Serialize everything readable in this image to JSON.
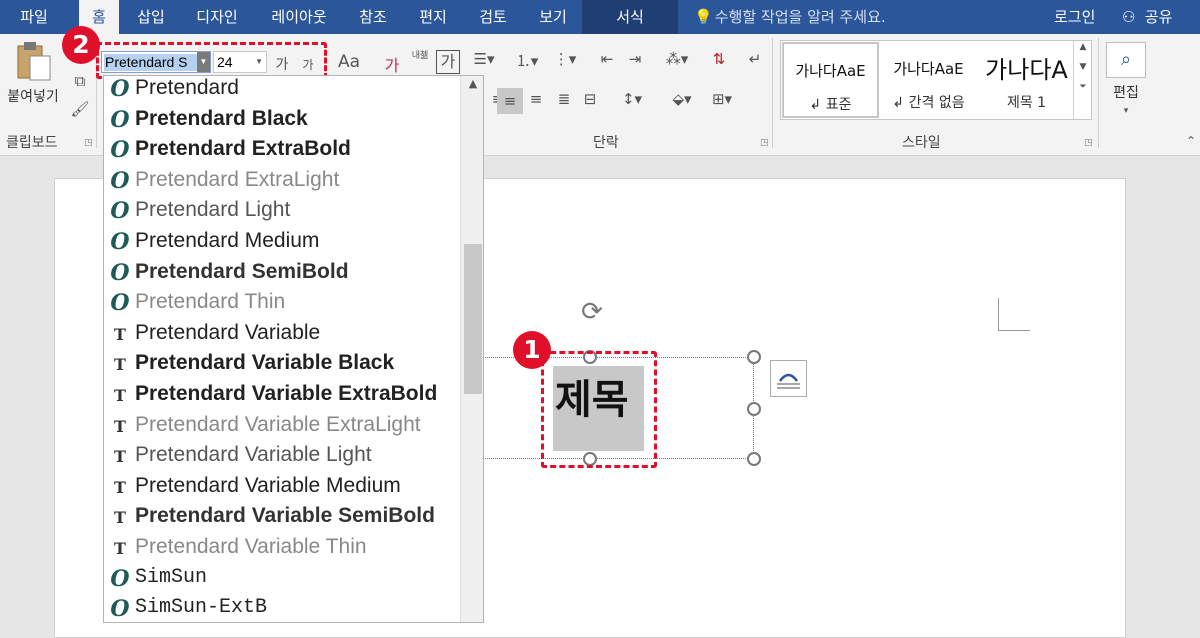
{
  "tabs": [
    "파일",
    "홈",
    "삽입",
    "디자인",
    "레이아웃",
    "참조",
    "편지",
    "검토",
    "보기",
    "서식"
  ],
  "active_tab": "홈",
  "tell_me": "수행할 작업을 알려 주세요.",
  "login": "로그인",
  "share": "공유",
  "clipboard": {
    "paste": "붙여넣기",
    "label": "클립보드"
  },
  "font_group": {
    "font_name": "Pretendard S",
    "font_size": "24",
    "grow": "가",
    "shrink": "가",
    "change_case": "Aa",
    "clear_format": "가",
    "phonetic": "내첾",
    "char_border": "가"
  },
  "paragraph_label": "단락",
  "styles": {
    "label": "스타일",
    "items": [
      {
        "sample": "가나다AaE",
        "name": "↲ 표준"
      },
      {
        "sample": "가나다AaE",
        "name": "↲ 간격 없음"
      },
      {
        "sample": "가나다A",
        "name": "제목 1"
      }
    ]
  },
  "editing": {
    "label": "편집"
  },
  "document": {
    "title_text": "제목"
  },
  "annotations": {
    "badge1": "1",
    "badge2": "2"
  },
  "font_list": [
    {
      "name": "Pretendard",
      "icon": "opentype-icon",
      "weight": "normal"
    },
    {
      "name": "Pretendard Black",
      "icon": "opentype-icon",
      "weight": "900"
    },
    {
      "name": "Pretendard ExtraBold",
      "icon": "opentype-icon",
      "weight": "800"
    },
    {
      "name": "Pretendard ExtraLight",
      "icon": "opentype-icon",
      "weight": "200"
    },
    {
      "name": "Pretendard Light",
      "icon": "opentype-icon",
      "weight": "300"
    },
    {
      "name": "Pretendard Medium",
      "icon": "opentype-icon",
      "weight": "500"
    },
    {
      "name": "Pretendard SemiBold",
      "icon": "opentype-icon",
      "weight": "600"
    },
    {
      "name": "Pretendard Thin",
      "icon": "opentype-icon",
      "weight": "100"
    },
    {
      "name": "Pretendard Variable",
      "icon": "truetype-icon",
      "weight": "normal"
    },
    {
      "name": "Pretendard Variable Black",
      "icon": "truetype-icon",
      "weight": "900"
    },
    {
      "name": "Pretendard Variable ExtraBold",
      "icon": "truetype-icon",
      "weight": "800"
    },
    {
      "name": "Pretendard Variable ExtraLight",
      "icon": "truetype-icon",
      "weight": "200"
    },
    {
      "name": "Pretendard Variable Light",
      "icon": "truetype-icon",
      "weight": "300"
    },
    {
      "name": "Pretendard Variable Medium",
      "icon": "truetype-icon",
      "weight": "500"
    },
    {
      "name": "Pretendard Variable SemiBold",
      "icon": "truetype-icon",
      "weight": "600"
    },
    {
      "name": "Pretendard Variable Thin",
      "icon": "truetype-icon",
      "weight": "100"
    },
    {
      "name": "SimSun",
      "icon": "opentype-icon",
      "weight": "normal"
    },
    {
      "name": "SimSun-ExtB",
      "icon": "opentype-icon",
      "weight": "normal"
    }
  ],
  "colors": {
    "accent": "#2b579a",
    "highlight_red": "#e0102a",
    "selection": "#b6d0ef"
  }
}
